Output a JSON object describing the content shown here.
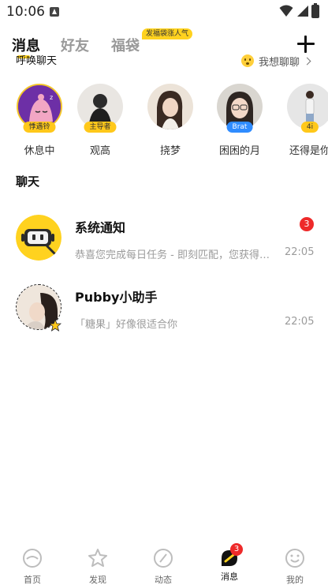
{
  "status_bar": {
    "time": "10:06"
  },
  "top_tabs": {
    "tabs": [
      {
        "label": "消息",
        "active": true
      },
      {
        "label": "好友",
        "active": false
      },
      {
        "label": "福袋",
        "active": false
      }
    ],
    "badge": "发福袋涨人气"
  },
  "summon": {
    "label": "呼唤聊天",
    "want_chat": "我想聊聊"
  },
  "stories": [
    {
      "name": "休息中",
      "tag": "悸遇铃",
      "tag_color": "yellow"
    },
    {
      "name": "观高",
      "tag": "主导者",
      "tag_color": "yellow"
    },
    {
      "name": "挠梦",
      "tag": "",
      "tag_color": ""
    },
    {
      "name": "困困的月",
      "tag": "Brat",
      "tag_color": "blue"
    },
    {
      "name": "还得是你",
      "tag": "4i",
      "tag_color": "yellow"
    }
  ],
  "chat_section": {
    "title": "聊天"
  },
  "chats": [
    {
      "name": "系统通知",
      "preview": "恭喜您完成每日任务 - 即刻匹配，您获得了奖励",
      "time": "22:05",
      "unread": "3"
    },
    {
      "name": "Pubby小助手",
      "preview": "「糖果」好像很适合你",
      "time": "22:05",
      "unread": ""
    }
  ],
  "bottom_nav": {
    "items": [
      {
        "label": "首页",
        "icon": "home-icon",
        "active": false
      },
      {
        "label": "发现",
        "icon": "discover-icon",
        "active": false
      },
      {
        "label": "动态",
        "icon": "moments-icon",
        "active": false
      },
      {
        "label": "消息",
        "icon": "message-icon",
        "active": true,
        "badge": "3"
      },
      {
        "label": "我的",
        "icon": "profile-icon",
        "active": false
      }
    ]
  },
  "colors": {
    "accent": "#ffd21f",
    "badge_red": "#ee2a2a",
    "tag_blue": "#2f8cff"
  }
}
